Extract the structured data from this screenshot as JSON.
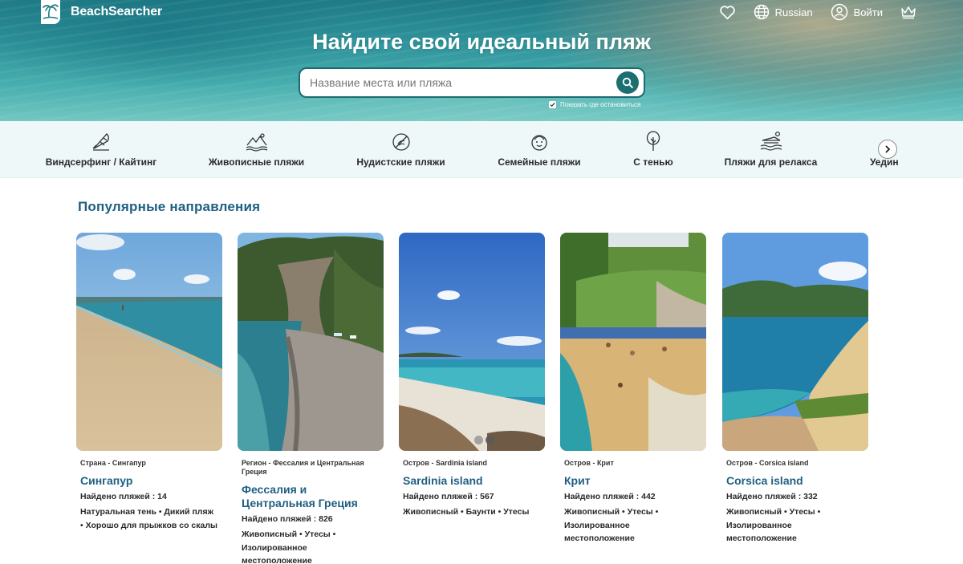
{
  "header": {
    "brand": "BeachSearcher",
    "language": "Russian",
    "login": "Войти",
    "icons": [
      "favorites-heart-icon",
      "globe-icon",
      "user-icon",
      "crown-icon"
    ]
  },
  "hero": {
    "title": "Найдите свой идеальный пляж",
    "search_placeholder": "Название места или пляжа",
    "stay_checkbox": "Показать где остановиться",
    "stay_checked": true
  },
  "categories": [
    {
      "label": "Виндсерфинг / Кайтинг",
      "icon": "windsurf-icon"
    },
    {
      "label": "Живописные пляжи",
      "icon": "scenic-icon"
    },
    {
      "label": "Нудистские пляжи",
      "icon": "nudist-icon"
    },
    {
      "label": "Семейные пляжи",
      "icon": "family-icon"
    },
    {
      "label": "С тенью",
      "icon": "shade-tree-icon"
    },
    {
      "label": "Пляжи для релакса",
      "icon": "relax-icon"
    },
    {
      "label": "Уедин",
      "icon": ""
    }
  ],
  "popular": {
    "title": "Популярные направления",
    "cards": [
      {
        "type": "Страна - Сингапур",
        "name": "Сингапур",
        "count": "Найдено пляжей : 14",
        "tags": "Натуральная тень • Дикий пляж • Хорошо для прыжков со скалы"
      },
      {
        "type": "Регион - Фессалия и Центральная Греция",
        "name": "Фессалия и Центральная Греция",
        "count": "Найдено пляжей : 826",
        "tags": "Живописный • Утесы • Изолированное местоположение"
      },
      {
        "type": "Остров - Sardinia island",
        "name": "Sardinia island",
        "count": "Найдено пляжей : 567",
        "tags": "Живописный • Баунти • Утесы"
      },
      {
        "type": "Остров - Крит",
        "name": "Крит",
        "count": "Найдено пляжей : 442",
        "tags": "Живописный • Утесы • Изолированное местоположение"
      },
      {
        "type": "Остров - Corsica island",
        "name": "Corsica island",
        "count": "Найдено пляжей : 332",
        "tags": "Живописный • Утесы • Изолированное местоположение"
      }
    ]
  },
  "colors": {
    "brand": "#1b6f71",
    "heading": "#1f5f82",
    "category_bg": "#eff8f8"
  }
}
